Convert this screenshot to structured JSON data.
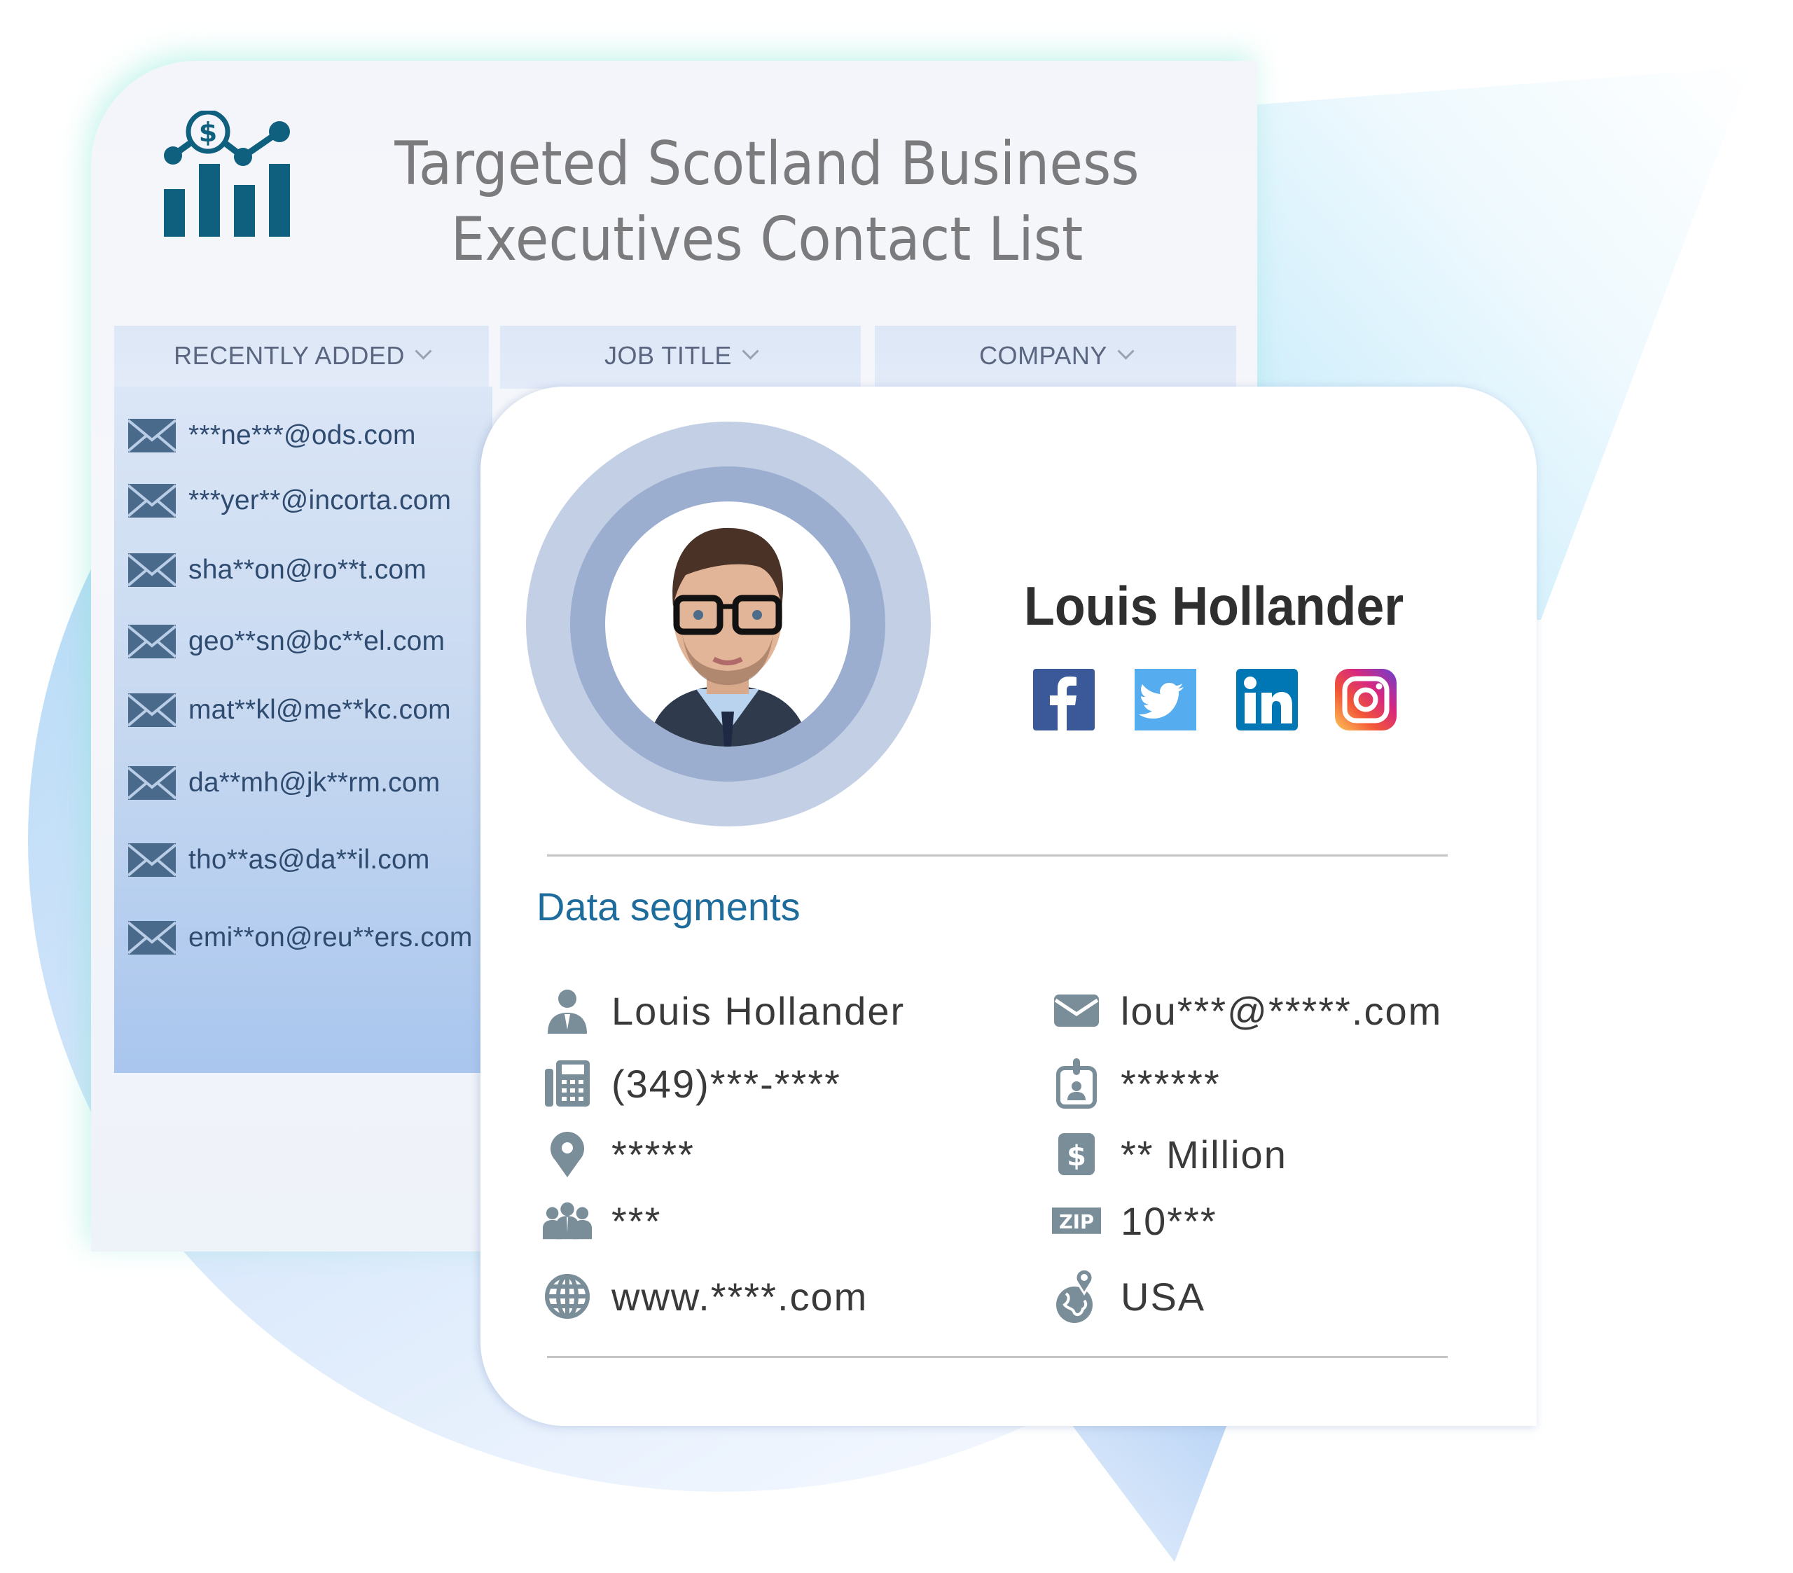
{
  "header": {
    "title_line1": "Targeted Scotland Business",
    "title_line2": "Executives Contact List",
    "logo_icon": "chart-dollar-icon"
  },
  "tabs": [
    {
      "label": "RECENTLY ADDED",
      "icon": "chevron-down-icon"
    },
    {
      "label": "JOB TITLE",
      "icon": "chevron-down-icon"
    },
    {
      "label": "COMPANY",
      "icon": "chevron-down-icon"
    }
  ],
  "recent_emails": [
    "***ne***@ods.com",
    "***yer**@incorta.com",
    "sha**on@ro**t.com",
    "geo**sn@bc**el.com",
    "mat**kl@me**kc.com",
    "da**mh@jk**rm.com",
    "tho**as@da**il.com",
    "emi**on@reu**ers.com"
  ],
  "profile": {
    "name": "Louis Hollander",
    "social": [
      {
        "name": "facebook",
        "color": "#3b5998"
      },
      {
        "name": "twitter",
        "color": "#55acee"
      },
      {
        "name": "linkedin",
        "color": "#0077b5"
      },
      {
        "name": "instagram",
        "color": "#c13584"
      }
    ]
  },
  "segments": {
    "title": "Data segments",
    "left": [
      {
        "icon": "person-icon",
        "value": "Louis Hollander"
      },
      {
        "icon": "phone-icon",
        "value": "(349)***-****"
      },
      {
        "icon": "location-pin-icon",
        "value": "*****"
      },
      {
        "icon": "group-icon",
        "value": "***"
      },
      {
        "icon": "globe-icon",
        "value": "www.****.com"
      }
    ],
    "right": [
      {
        "icon": "envelope-icon",
        "value": "lou***@*****.com"
      },
      {
        "icon": "id-badge-icon",
        "value": "******"
      },
      {
        "icon": "dollar-icon",
        "value": "** Million"
      },
      {
        "icon": "zip-icon",
        "value": "10***",
        "badge": "ZIP"
      },
      {
        "icon": "globe-pin-icon",
        "value": "USA"
      }
    ]
  },
  "colors": {
    "logo": "#0f5f7e",
    "segment_title": "#1d6c9c",
    "icon_gray": "#7a8e9a",
    "email_text": "#2f4c70"
  }
}
